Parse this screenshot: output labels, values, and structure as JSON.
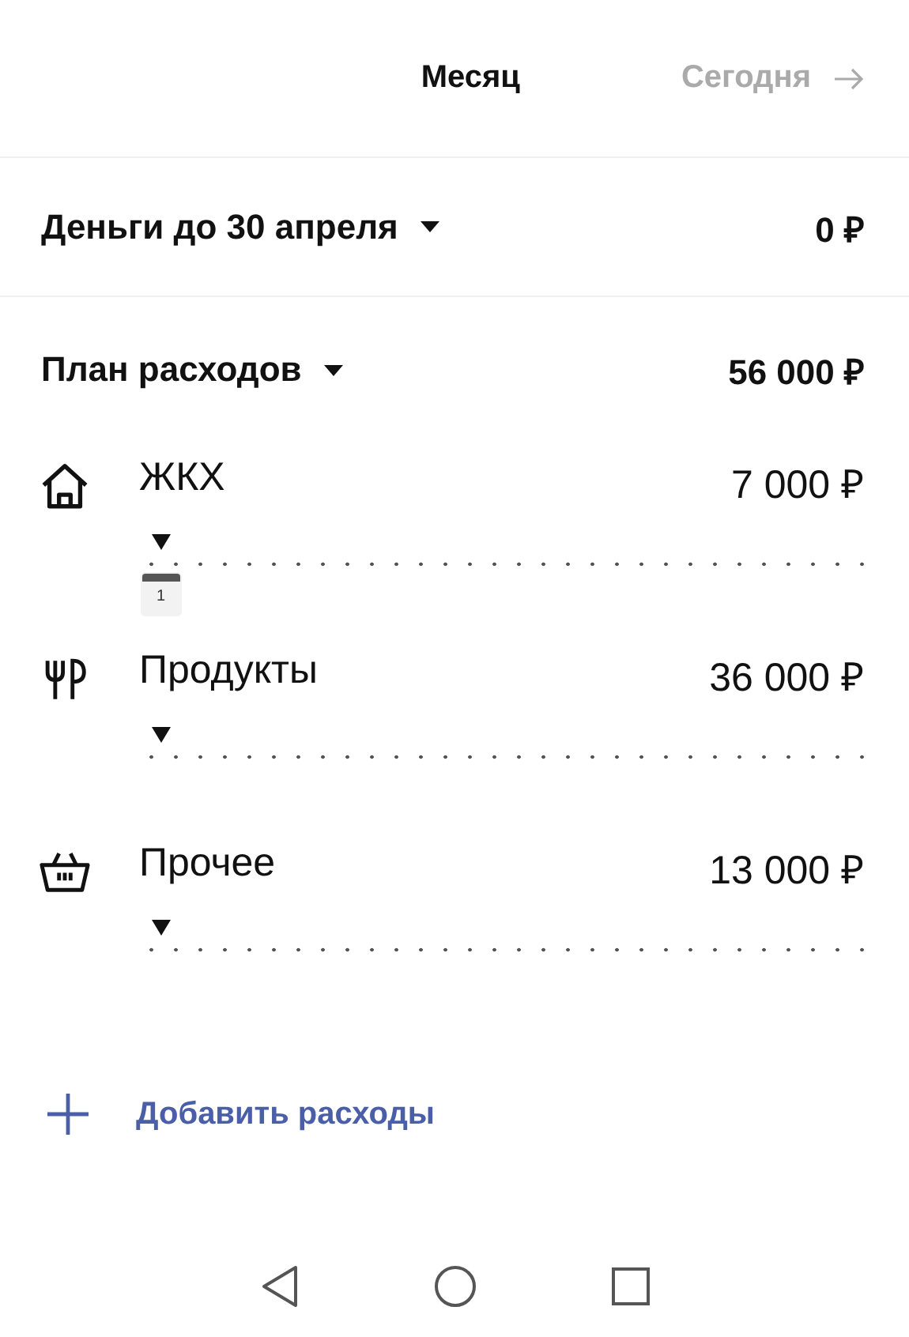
{
  "header": {
    "period": "Месяц",
    "today": {
      "label": "Сегодня",
      "disabled": true
    }
  },
  "balance": {
    "label": "Деньги до 30 апреля",
    "amount": "0 ₽"
  },
  "plan": {
    "label": "План расходов",
    "amount": "56 000 ₽"
  },
  "categories": [
    {
      "kind": "house",
      "name": "ЖКХ",
      "amount": "7 000 ₽",
      "level": 0.03,
      "day_badge": "1"
    },
    {
      "kind": "food",
      "name": "Продукты",
      "amount": "36 000 ₽",
      "level": 0.03
    },
    {
      "kind": "basket",
      "name": "Прочее",
      "amount": "13 000 ₽",
      "level": 0.03
    }
  ],
  "add_button": {
    "label": "Добавить расходы"
  }
}
